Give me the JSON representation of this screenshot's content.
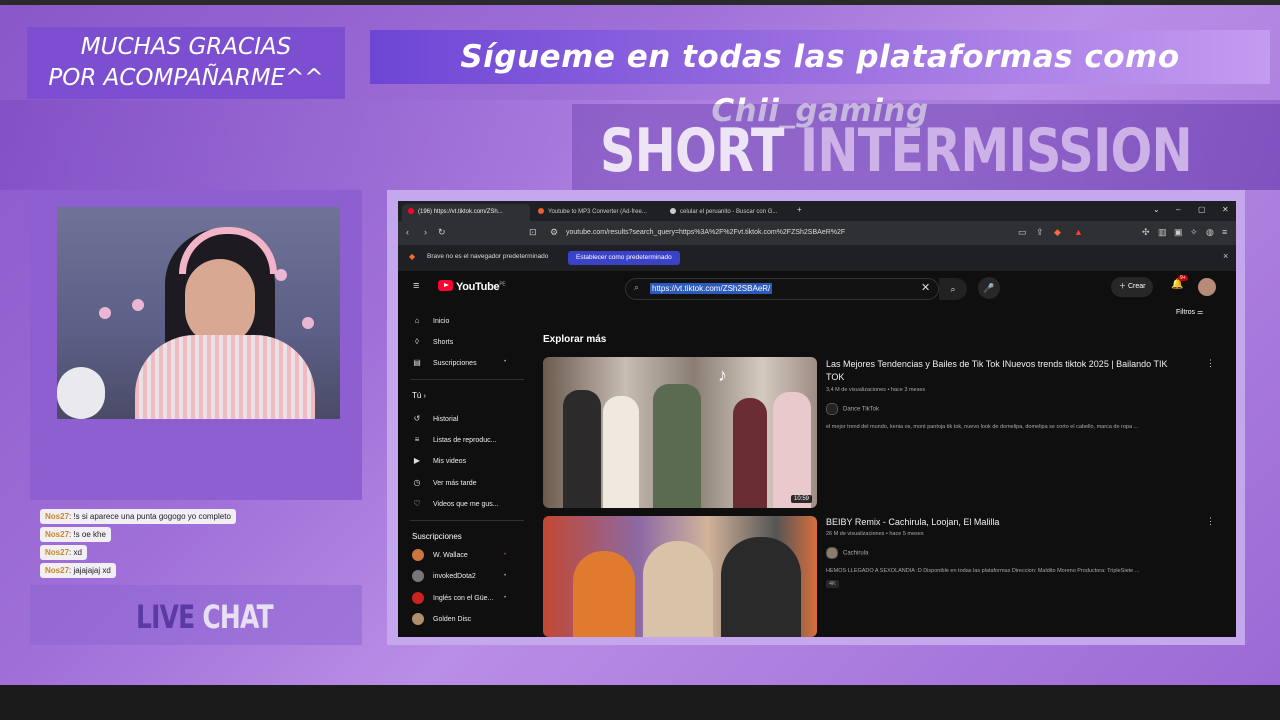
{
  "overlay": {
    "thanks_line1": "MUCHAS GRACIAS",
    "thanks_line2": "POR ACOMPAÑARME^^",
    "follow_banner": "Sígueme en todas las plataformas como Chii_gaming",
    "intermission_word1": "SHORT",
    "intermission_word2": "INTERMISSION",
    "livechat_word1": "LIVE",
    "livechat_word2": "CHAT"
  },
  "chat": [
    {
      "user": "Nos27",
      "text": ": !s si aparece una punta gogogo yo completo"
    },
    {
      "user": "Nos27",
      "text": ": !s oe khe"
    },
    {
      "user": "Nos27",
      "text": ": xd"
    },
    {
      "user": "Nos27",
      "text": ": jajajajaj xd"
    }
  ],
  "browser": {
    "tabs": [
      {
        "label": "(196) https://vt.tiktok.com/ZSh...",
        "fav_color": "#ff0033"
      },
      {
        "label": "Youtube to MP3 Converter (Ad-free...",
        "fav_color": "#e8602c"
      },
      {
        "label": "celular el peruanito - Buscar con G...",
        "fav_color": "#cccccc"
      }
    ],
    "url": "youtube.com/results?search_query=https%3A%2F%2Fvt.tiktok.com%2FZSh2SBAeR%2F",
    "infobar_text": "Brave no es el navegador predeterminado",
    "infobar_button": "Establecer como predeterminado",
    "close_glyph": "×"
  },
  "youtube": {
    "logo_text": "YouTube",
    "logo_region": "PE",
    "search_value": "https://vt.tiktok.com/ZSh2SBAeR/",
    "create_label": "Crear",
    "notif_count": "9+",
    "filters_label": "Filtros",
    "explore_heading": "Explorar más",
    "sidebar_main": [
      {
        "label": "Inicio",
        "icon": "⌂"
      },
      {
        "label": "Shorts",
        "icon": "◊"
      },
      {
        "label": "Suscripciones",
        "icon": "▤"
      }
    ],
    "you_heading": "Tú",
    "sidebar_you": [
      {
        "label": "Historial",
        "icon": "↺"
      },
      {
        "label": "Listas de reproduc...",
        "icon": "≡"
      },
      {
        "label": "Mis videos",
        "icon": "▶"
      },
      {
        "label": "Ver más tarde",
        "icon": "◷"
      },
      {
        "label": "Videos que me gus...",
        "icon": "👍"
      }
    ],
    "subs_heading": "Suscripciones",
    "subscriptions": [
      {
        "label": "W. Wallace",
        "color": "#c9773f"
      },
      {
        "label": "invokedDota2",
        "color": "#777777"
      },
      {
        "label": "Inglés con el Güe...",
        "color": "#cc2222"
      },
      {
        "label": "Golden Disc",
        "color": "#b08f6f"
      }
    ],
    "videos": [
      {
        "title": "Las Mejores Tendencias y Bailes de Tik Tok INuevos trends tiktok 2025 | Bailando TIK TOK",
        "meta": "3,4 M de visualizaciones • hace 3 meses",
        "channel": "Dance TikTok",
        "description": "el mejor trend del mundo, kenia os, mont pantoja tik tok, nuevo look de domelipa, domelipa se corto el cabello, marca de ropa ...",
        "duration": "10:59"
      },
      {
        "title": "BEIBY Remix - Cachirula, Loojan, El Malilla",
        "meta": "26 M de visualizaciones • hace 5 meses",
        "channel": "Cachirula",
        "description": "HEMOS LLEGADO A SEXOLANDIA :D Disponible en todas las plataformas Direccion: Maldito Moreno Productora: TripleSiete ...",
        "badge": "4K"
      }
    ]
  }
}
